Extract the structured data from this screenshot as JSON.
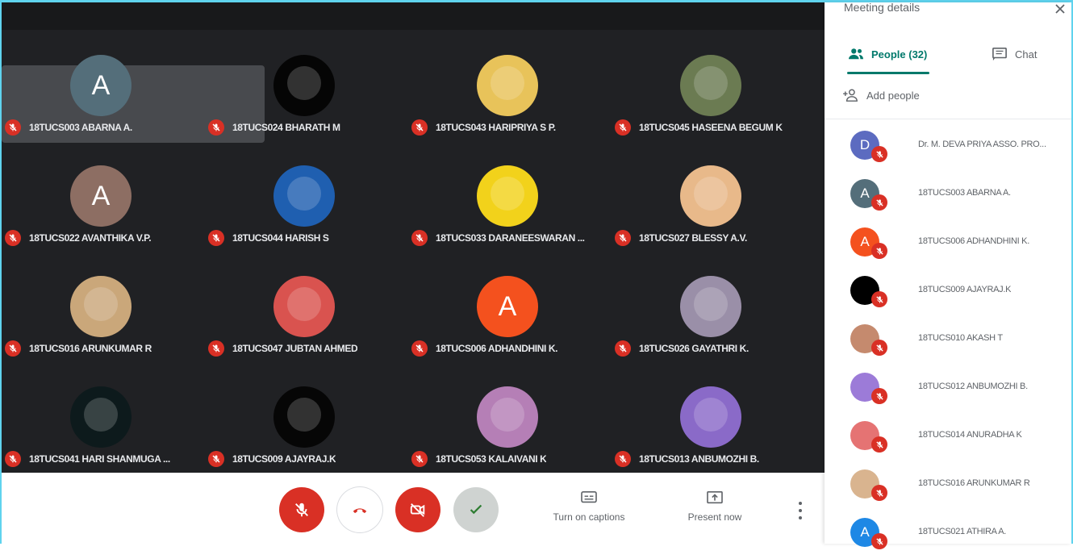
{
  "panel": {
    "title": "Meeting details",
    "tab_people": "People (32)",
    "tab_chat": "Chat",
    "add_people": "Add people",
    "participants": [
      {
        "initial": "D",
        "name": "Dr. M. DEVA PRIYA ASSO. PRO...",
        "color": "#5c6bc0"
      },
      {
        "initial": "A",
        "name": "18TUCS003 ABARNA A.",
        "color": "#546e7a"
      },
      {
        "initial": "A",
        "name": "18TUCS006 ADHANDHINI K.",
        "color": "#f4511e"
      },
      {
        "initial": "",
        "name": "18TUCS009 AJAYRAJ.K",
        "color": "#000000"
      },
      {
        "initial": "",
        "name": "18TUCS010 AKASH T",
        "color": "#c58a6e"
      },
      {
        "initial": "",
        "name": "18TUCS012 ANBUMOZHI B.",
        "color": "#9c7bd8"
      },
      {
        "initial": "",
        "name": "18TUCS014 ANURADHA K",
        "color": "#e57373"
      },
      {
        "initial": "",
        "name": "18TUCS016 ARUNKUMAR R",
        "color": "#d9b48f"
      },
      {
        "initial": "A",
        "name": "18TUCS021 ATHIRA A.",
        "color": "#1e88e5"
      }
    ]
  },
  "tiles": [
    {
      "initial": "A",
      "name": "18TUCS003 ABARNA A.",
      "color": "#546e7a"
    },
    {
      "initial": "",
      "name": "18TUCS024 BHARATH M",
      "color": "#050505"
    },
    {
      "initial": "",
      "name": "18TUCS043 HARIPRIYA S P.",
      "color": "#e8c35a"
    },
    {
      "initial": "",
      "name": "18TUCS045 HASEENA BEGUM K",
      "color": "#6b7b52"
    },
    {
      "initial": "A",
      "name": "18TUCS022 AVANTHIKA V.P.",
      "color": "#8d6e63"
    },
    {
      "initial": "",
      "name": "18TUCS044 HARISH S",
      "color": "#1f5fb0"
    },
    {
      "initial": "",
      "name": "18TUCS033 DARANEESWARAN ...",
      "color": "#f2d21b"
    },
    {
      "initial": "",
      "name": "18TUCS027 BLESSY A.V.",
      "color": "#e8b98a"
    },
    {
      "initial": "",
      "name": "18TUCS016 ARUNKUMAR R",
      "color": "#caa77a"
    },
    {
      "initial": "",
      "name": "18TUCS047 JUBTAN AHMED",
      "color": "#d9534f"
    },
    {
      "initial": "A",
      "name": "18TUCS006 ADHANDHINI K.",
      "color": "#f4511e"
    },
    {
      "initial": "",
      "name": "18TUCS026 GAYATHRI K.",
      "color": "#9a8fa8"
    },
    {
      "initial": "",
      "name": "18TUCS041 HARI SHANMUGA ...",
      "color": "#0d1a1c"
    },
    {
      "initial": "",
      "name": "18TUCS009 AJAYRAJ.K",
      "color": "#060606"
    },
    {
      "initial": "",
      "name": "18TUCS053 KALAIVANI K",
      "color": "#b57fb6"
    },
    {
      "initial": "",
      "name": "18TUCS013 ANBUMOZHI B.",
      "color": "#8a6ac8"
    }
  ],
  "toolbar": {
    "captions_label": "Turn on captions",
    "present_label": "Present now"
  },
  "colors": {
    "stage": "#202124",
    "accent": "#00796b",
    "danger": "#d93025"
  }
}
